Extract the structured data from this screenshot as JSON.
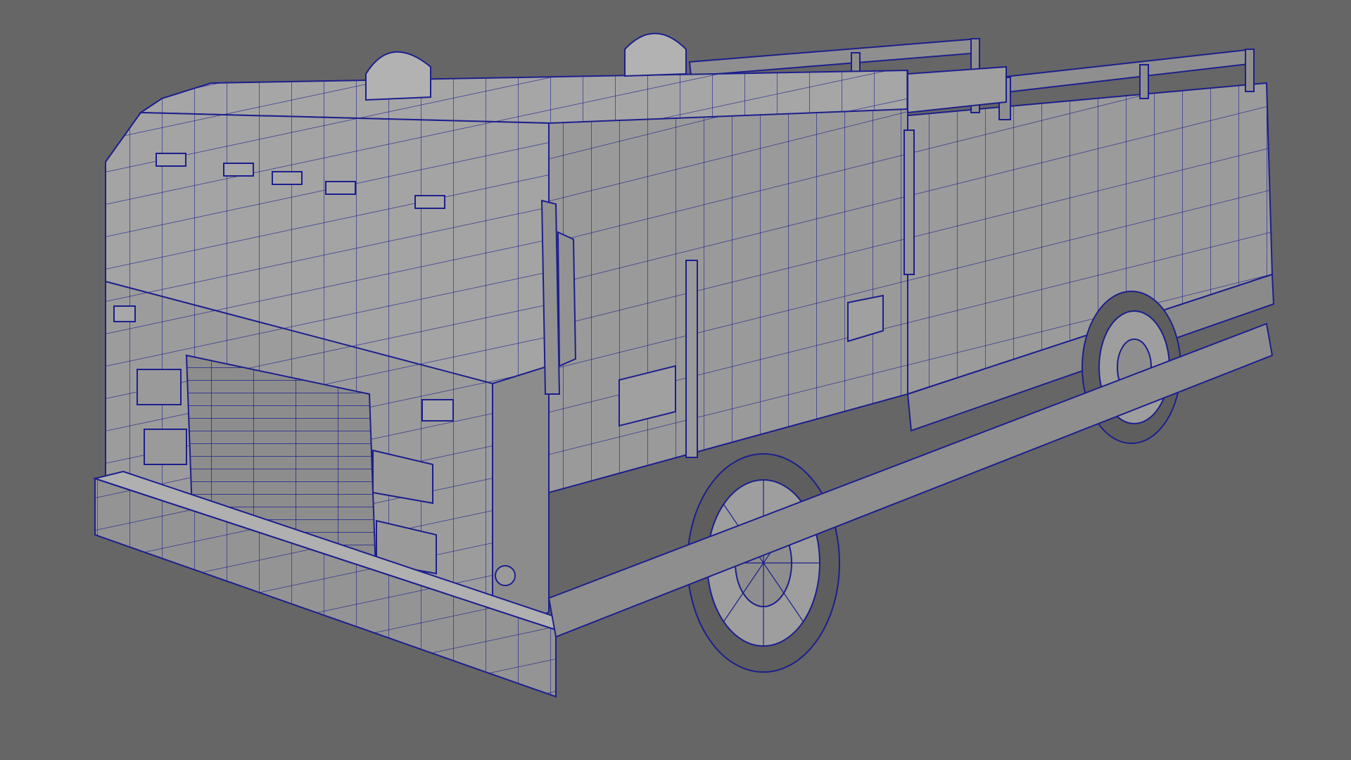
{
  "viewport": {
    "view_mode": "perspective",
    "display_mode": "smooth-shaded-with-wireframe",
    "background_color": "#666666",
    "wire_color": "#1c1f8c",
    "surface_light": "#a2a2a2",
    "surface_mid": "#949494",
    "surface_dark": "#7f7f7f",
    "tire_color": "#5c5c5c"
  },
  "model": {
    "subject": "fire-truck",
    "parts": [
      "cab",
      "front-grille",
      "front-bumper",
      "cab-roof-lights",
      "beacon-lights",
      "side-mirror",
      "cab-door",
      "grab-handles",
      "body-compartments",
      "top-ladder-rack",
      "front-wheel",
      "rear-wheel"
    ]
  }
}
